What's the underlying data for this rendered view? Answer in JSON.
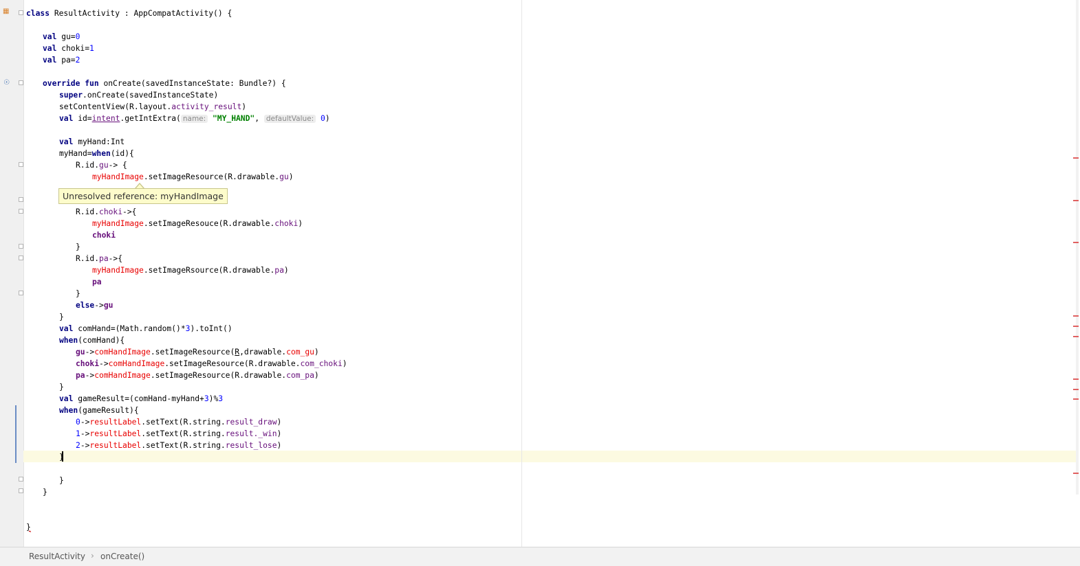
{
  "tooltip": {
    "text": "Unresolved reference: myHandImage"
  },
  "breadcrumb": {
    "items": [
      "ResultActivity",
      "onCreate()"
    ],
    "separator": "›"
  },
  "code": {
    "l1": [
      "class",
      " ResultActivity : AppCompatActivity() {"
    ],
    "l2": [
      "val",
      " gu=",
      "0"
    ],
    "l3": [
      "val",
      " choki=",
      "1"
    ],
    "l4": [
      "val",
      " pa=",
      "2"
    ],
    "l5": [
      "override",
      " ",
      "fun",
      " onCreate(savedInstanceState: Bundle?) {"
    ],
    "l6": [
      "super",
      ".onCreate(savedInstanceState)"
    ],
    "l7": [
      "setContentView(R.layout.",
      "activity_result",
      ")"
    ],
    "l8": [
      "val",
      " id=",
      "intent",
      ".getIntExtra(",
      "name:",
      "\"MY_HAND\"",
      ",",
      "defaultValue:",
      "0",
      ")"
    ],
    "l9": [
      "val",
      " myHand:Int"
    ],
    "l10": [
      "myHand=",
      "when",
      "(id){"
    ],
    "l11": [
      "R.id.",
      "gu",
      "-> {"
    ],
    "l12": [
      "myHandImage",
      ".setImageResource(R.drawable.",
      "gu",
      ")"
    ],
    "l14": [
      "R.id.",
      "choki",
      "->{"
    ],
    "l15": [
      "myHandImage",
      ".setImageResouce(R.drawable.",
      "choki",
      ")"
    ],
    "l16": [
      "choki"
    ],
    "l17": [
      "}"
    ],
    "l18": [
      "R.id.",
      "pa",
      "->{"
    ],
    "l19": [
      "myHandImage",
      ".setImageRsource(R.drawable.",
      "pa",
      ")"
    ],
    "l20": [
      "pa"
    ],
    "l21": [
      "}"
    ],
    "l22": [
      "else",
      "->",
      "gu"
    ],
    "l23": [
      "}"
    ],
    "l24": [
      "val",
      " comHand=(Math.random()*",
      "3",
      ").toInt()"
    ],
    "l25": [
      "when",
      "(comHand){"
    ],
    "l26": [
      "gu",
      "->",
      "comHandImage",
      ".setImageResource(",
      "R",
      ",drawable.",
      "com_gu",
      ")"
    ],
    "l27": [
      "choki",
      "->",
      "comHandImage",
      ".setImageResource(R.drawable.",
      "com_choki",
      ")"
    ],
    "l28": [
      "pa",
      "->",
      "comHandImage",
      ".setImageResource(R.drawable.",
      "com_pa",
      ")"
    ],
    "l29": [
      "}"
    ],
    "l30": [
      "val",
      " gameResult=(comHand-myHand+",
      "3",
      ")%",
      "3"
    ],
    "l31": [
      "when",
      "(gameResult){"
    ],
    "l32": [
      "0",
      "->",
      "resultLabel",
      ".setText(R.string.",
      "result_draw",
      ")"
    ],
    "l33": [
      "1",
      "->",
      "resultLabel",
      ".setText(R.string.",
      "result._win",
      ")"
    ],
    "l34": [
      "2",
      "->",
      "resultLabel",
      ".setText(R.string.",
      "result_lose",
      ")"
    ],
    "l35": [
      "}"
    ],
    "l36": [
      "}"
    ],
    "l37": [
      "}"
    ],
    "l38": [
      "}"
    ]
  }
}
